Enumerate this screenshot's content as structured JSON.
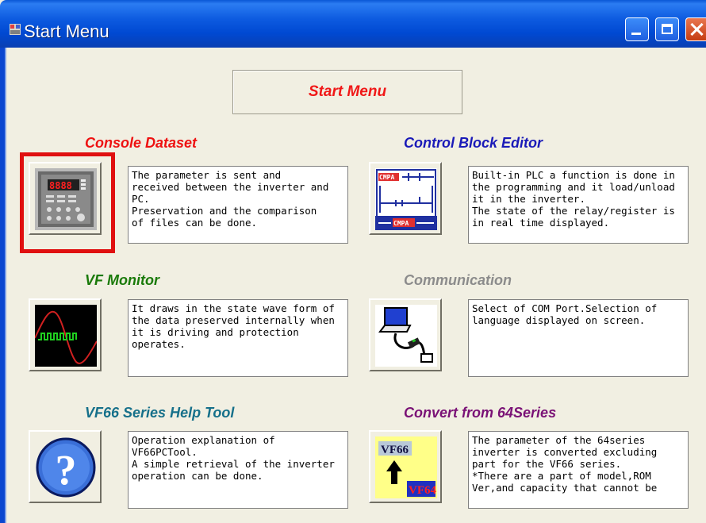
{
  "window": {
    "title": "Start Menu",
    "header": "Start Menu"
  },
  "sections": [
    {
      "id": "console",
      "title": "Console Dataset",
      "title_color": "#ee1111",
      "description": "The parameter is sent and\nreceived between the inverter and\nPC.\nPreservation and the comparison\nof files can be done.",
      "icon": "console-keypad-icon",
      "display": "8888"
    },
    {
      "id": "control-block",
      "title": "Control Block Editor",
      "title_color": "#1a1ab8",
      "description": "Built-in PLC a function is done in\nthe programming and it load/unload\nit in the inverter.\nThe state of the relay/register is\nin real time displayed.",
      "icon": "plc-ladder-icon",
      "labels": [
        "CMPA",
        "CMPA"
      ]
    },
    {
      "id": "vf-monitor",
      "title": "VF Monitor",
      "title_color": "#1a7a0a",
      "description": "It draws in the state wave form of\nthe data preserved internally when\nit is driving and protection\noperates.",
      "icon": "waveform-icon"
    },
    {
      "id": "communication",
      "title": "Communication",
      "title_color": "#8c8c8c",
      "description": "Select of COM Port.Selection of\nlanguage displayed on screen.",
      "icon": "laptop-cable-icon"
    },
    {
      "id": "help",
      "title": "VF66 Series Help Tool",
      "title_color": "#16708a",
      "description": "Operation explanation of\nVF66PCTool.\nA simple retrieval of the inverter\noperation can be done.",
      "icon": "help-question-icon"
    },
    {
      "id": "convert",
      "title": "Convert from 64Series",
      "title_color": "#7a1276",
      "description": "The parameter of the 64series\ninverter is converted excluding\npart for the VF66 series.\n*There are a part of model,ROM\nVer,and capacity that cannot be",
      "icon": "convert-arrow-icon",
      "labels": [
        "VF66",
        "VF64"
      ]
    }
  ]
}
